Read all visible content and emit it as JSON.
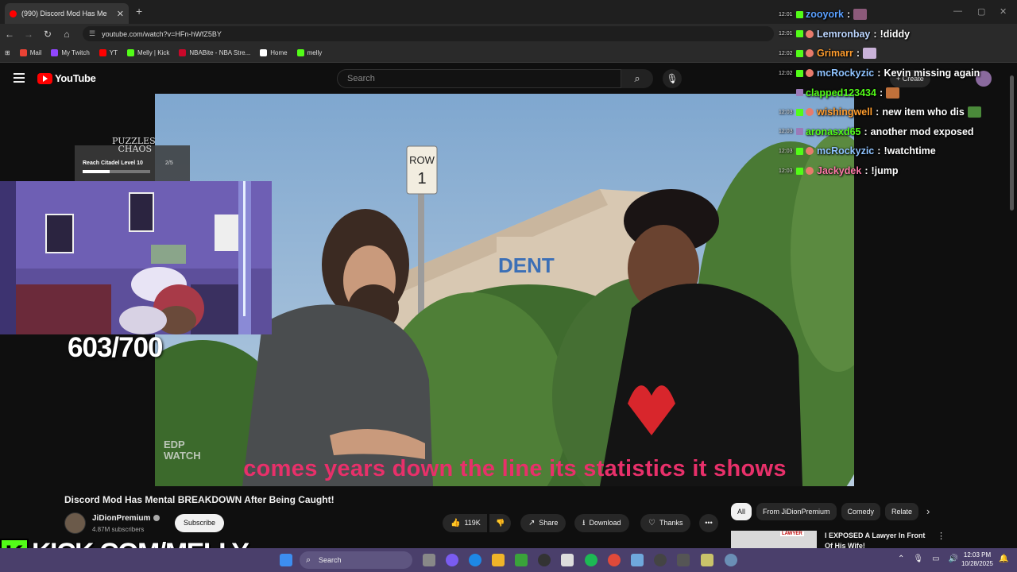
{
  "browser": {
    "tab_title": "(990) Discord Mod Has Me",
    "tab_close": "✕",
    "new_tab": "+",
    "url": "youtube.com/watch?v=HFn-hWfZ5BY",
    "window_controls": [
      "—",
      "▢",
      "✕"
    ],
    "bookmarks": [
      {
        "label": "Mail",
        "icon": "gmail-icon",
        "color": "#ea4335"
      },
      {
        "label": "My Twitch",
        "icon": "twitch-icon",
        "color": "#9146ff"
      },
      {
        "label": "YT",
        "icon": "youtube-icon",
        "color": "#ff0000"
      },
      {
        "label": "Melly | Kick",
        "icon": "kick-icon",
        "color": "#53fc18"
      },
      {
        "label": "NBABite - NBA Stre...",
        "icon": "nba-icon",
        "color": "#c9082a"
      },
      {
        "label": "Home",
        "icon": "x-icon",
        "color": "#ffffff"
      },
      {
        "label": "melly",
        "icon": "kick-icon",
        "color": "#53fc18"
      }
    ]
  },
  "youtube": {
    "logo": "YouTube",
    "search_placeholder": "Search",
    "create_label": "+ Create",
    "video_title": "Discord Mod Has Mental BREAKDOWN After Being Caught!",
    "channel": "JiDionPremium",
    "subscribers": "4.87M subscribers",
    "subscribe_label": "Subscribe",
    "likes": "119K",
    "share_label": "Share",
    "download_label": "Download",
    "thanks_label": "Thanks",
    "more_label": "•••",
    "chips": [
      "All",
      "From JiDionPremium",
      "Comedy",
      "Relate"
    ],
    "recommended_title": "I EXPOSED A Lawyer In Front Of His Wife!",
    "recommended_thumb_text": "LAWYER"
  },
  "video": {
    "subtitle": "comes years down the line its statistics it shows",
    "sign_row": "ROW",
    "sign_num": "1",
    "building_sign": "DENT",
    "watermark_1": "EDP",
    "watermark_2": "WATCH"
  },
  "overlay": {
    "puzzle_logo_1": "PUZZLES",
    "puzzle_logo_2": "CHAOS",
    "goal": "Reach Citadel Level 10",
    "goal_count": "2/5",
    "goal_progress": 0.4,
    "counter": "603/700",
    "kick_banner": "KICK.COM/MELLY"
  },
  "chat": [
    {
      "ts": "12:01",
      "user": "zooyork",
      "color": "#5aa0ff",
      "text": "",
      "badge": "kick",
      "emote": "#8c5a7a"
    },
    {
      "ts": "12:01",
      "user": "Lemronbay",
      "color": "#bcd6ff",
      "text": "!diddy",
      "badge": "kick",
      "emote": ""
    },
    {
      "ts": "12:02",
      "user": "Grimarr",
      "color": "#ff9d2e",
      "text": "",
      "badge": "kick",
      "emote": "#c9b2d8"
    },
    {
      "ts": "12:02",
      "user": "mcRockyzic",
      "color": "#8fc3ff",
      "text": "Kevin missing again",
      "badge": "kick",
      "emote": ""
    },
    {
      "ts": "",
      "user": "clapped123434",
      "color": "#53fc18",
      "text": "",
      "badge": "plain",
      "emote": "#c0703a"
    },
    {
      "ts": "12:03",
      "user": "wishingwell",
      "color": "#ff9d2e",
      "text": "new item who dis",
      "badge": "kick",
      "emote": "#4a8a3a"
    },
    {
      "ts": "12:03",
      "user": "aronasxd65",
      "color": "#53fc18",
      "text": "another mod exposed",
      "badge": "plain",
      "emote": ""
    },
    {
      "ts": "12:03",
      "user": "mcRockyzic",
      "color": "#8fc3ff",
      "text": "!watchtime",
      "badge": "kick",
      "emote": ""
    },
    {
      "ts": "12:03",
      "user": "Jackydek",
      "color": "#ff7aa8",
      "text": "!jump",
      "badge": "kick",
      "emote": ""
    }
  ],
  "taskbar": {
    "search_label": "Search",
    "time": "12:03 PM",
    "date": "10/28/2025"
  }
}
